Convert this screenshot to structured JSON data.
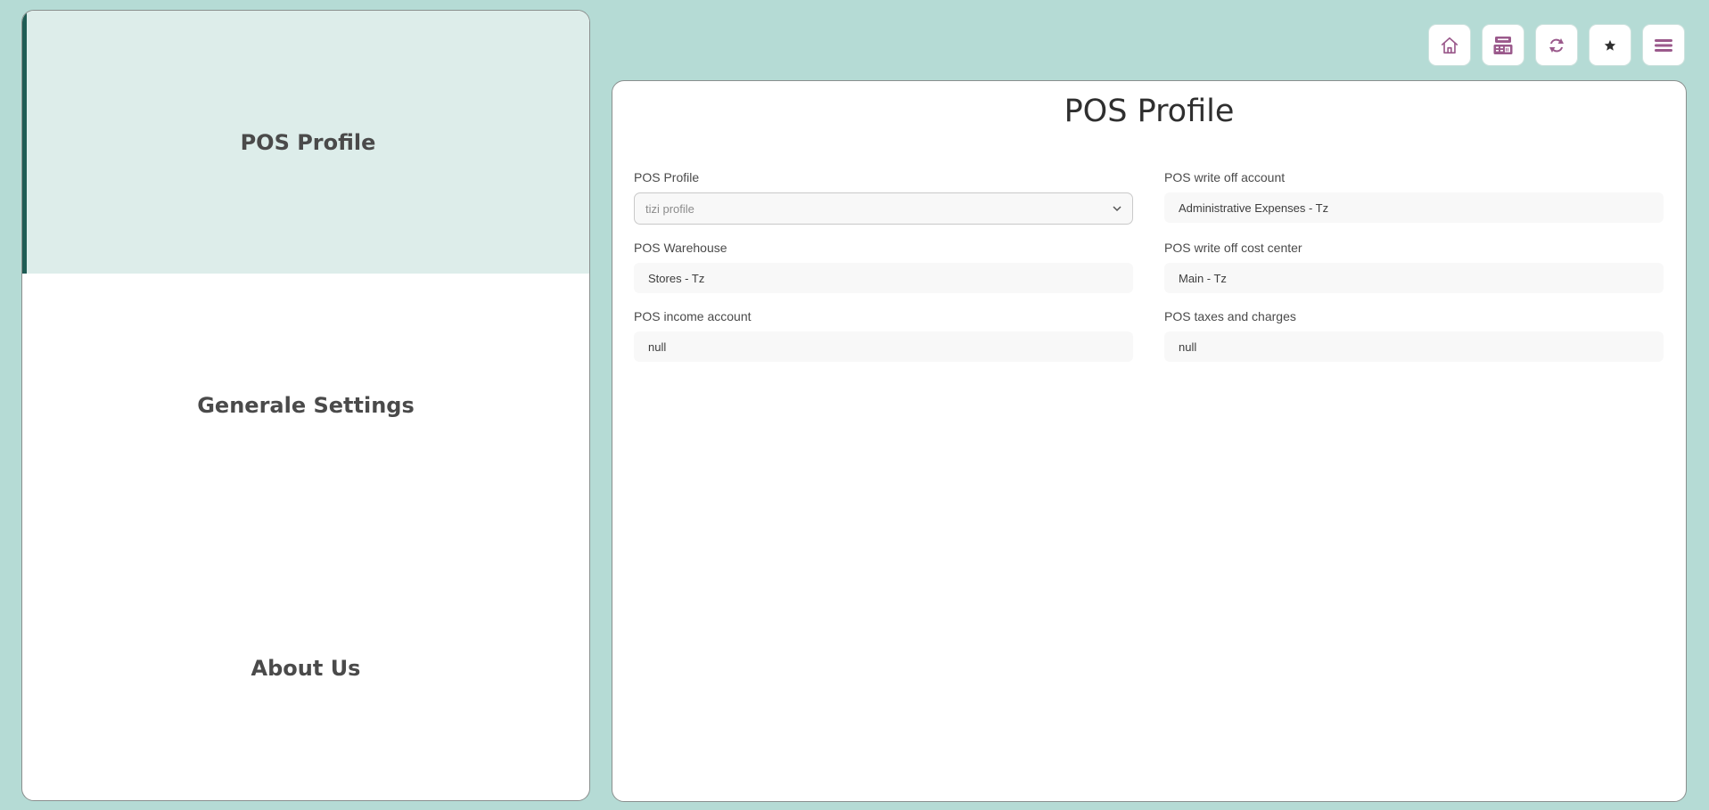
{
  "menu": {
    "items": [
      {
        "label": "POS Profile",
        "active": true
      },
      {
        "label": "Generale Settings",
        "active": false
      },
      {
        "label": "About Us",
        "active": false
      }
    ]
  },
  "toolbar": {
    "buttons": [
      {
        "icon": "home-icon"
      },
      {
        "icon": "pos-register-icon"
      },
      {
        "icon": "sync-icon"
      },
      {
        "icon": "star-icon"
      },
      {
        "icon": "menu-icon"
      }
    ],
    "icon_color": "#9b5a8c"
  },
  "page": {
    "title": "POS Profile"
  },
  "form": {
    "pos_profile": {
      "label": "POS Profile",
      "value": "tizi profile"
    },
    "write_off_account": {
      "label": "POS write off account",
      "value": "Administrative Expenses - Tz"
    },
    "warehouse": {
      "label": "POS Warehouse",
      "value": "Stores - Tz"
    },
    "write_off_cost_center": {
      "label": "POS write off cost center",
      "value": "Main - Tz"
    },
    "income_account": {
      "label": "POS income account",
      "value": "null"
    },
    "taxes_and_charges": {
      "label": "POS taxes and charges",
      "value": "null"
    }
  },
  "colors": {
    "background": "#b5dbd5",
    "active_item_bg": "#ddedea",
    "active_item_bar": "#1f5c54",
    "panel_border": "#8a8f8e"
  }
}
